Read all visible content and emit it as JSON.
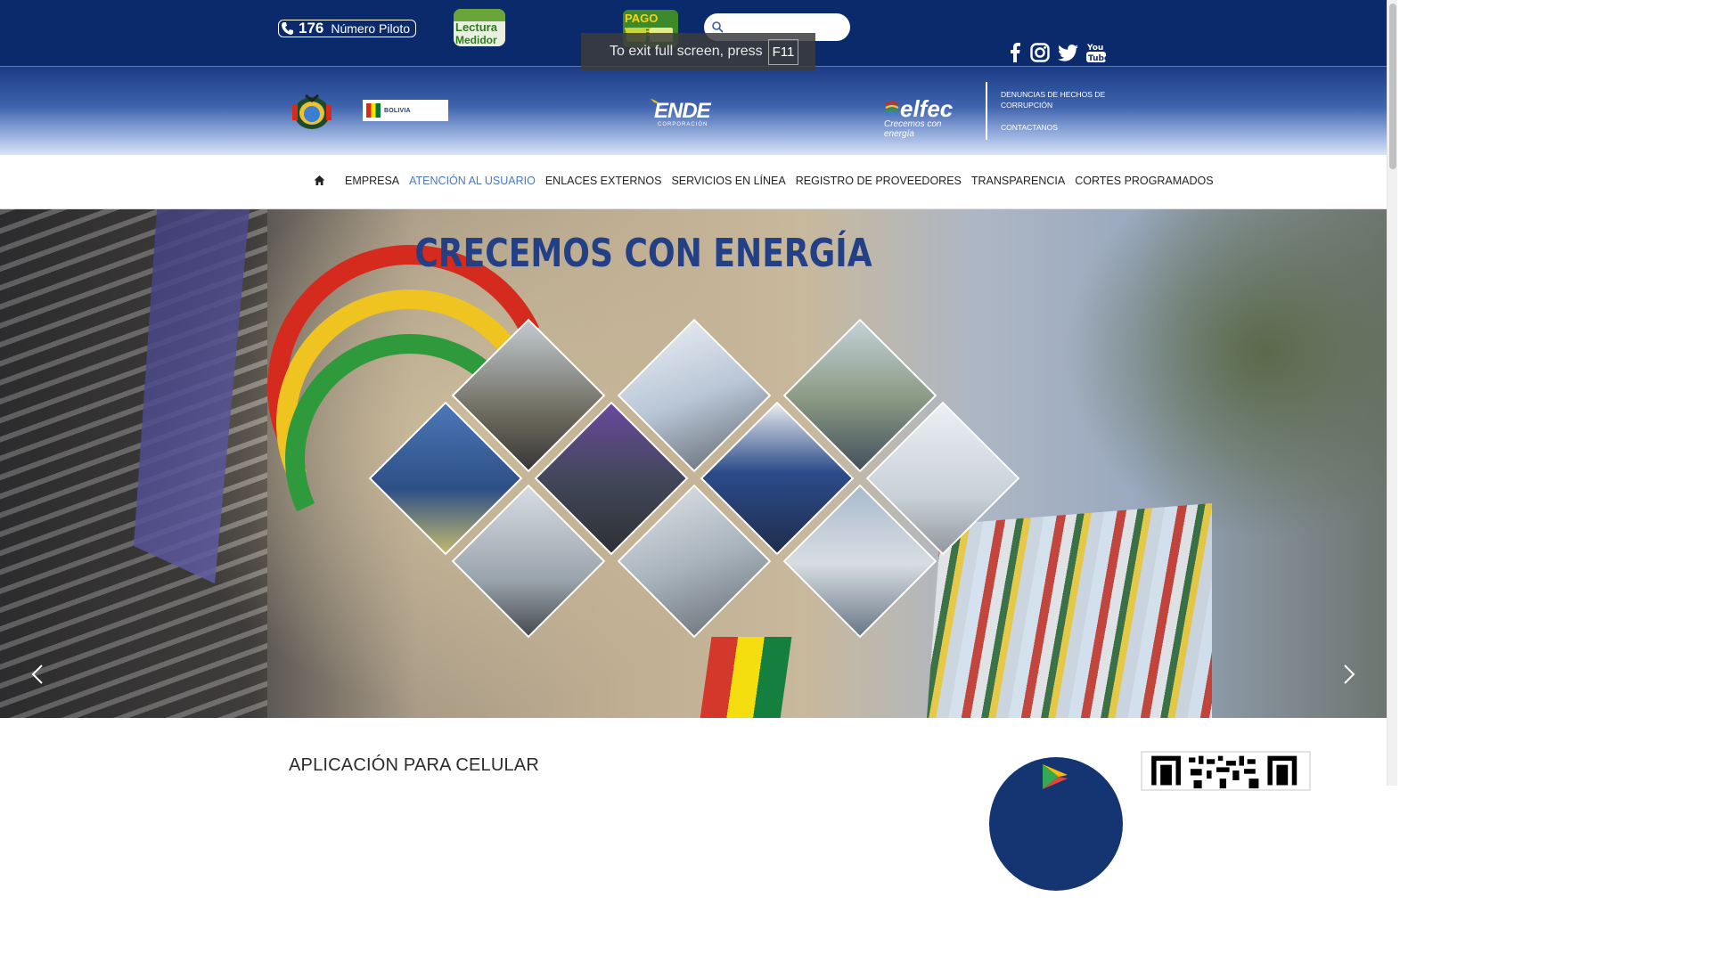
{
  "topbar": {
    "phone_number": "176",
    "phone_label": "Número Piloto",
    "lectura_line1": "Lectura",
    "lectura_line2": "Medidor",
    "pago_web": "PAGO WEB",
    "search_placeholder": "",
    "social": [
      "facebook-icon",
      "instagram-icon",
      "twitter-icon",
      "youtube-icon"
    ]
  },
  "fullscreen_notice": {
    "text": "To exit full screen, press",
    "key": "F11"
  },
  "logos": {
    "bolivia": "BOLIVIA",
    "ende": "ENDE",
    "ende_sub": "CORPORACIÓN",
    "elfec": "elfec",
    "elfec_tagline": "Crecemos con energía"
  },
  "sidelinks": {
    "denuncias": "DENUNCIAS DE HECHOS DE CORRUPCIÓN",
    "contactanos": "CONTACTANOS"
  },
  "nav": {
    "items": [
      {
        "label": "EMPRESA",
        "active": false
      },
      {
        "label": "ATENCIÓN AL USUARIO",
        "active": true
      },
      {
        "label": "ENLACES EXTERNOS",
        "active": false
      },
      {
        "label": "SERVICIOS EN LÍNEA",
        "active": false
      },
      {
        "label": "REGISTRO DE PROVEEDORES",
        "active": false
      },
      {
        "label": "TRANSPARENCIA",
        "active": false
      },
      {
        "label": "CORTES PROGRAMADOS",
        "active": false
      }
    ]
  },
  "hero": {
    "title": "CRECEMOS CON ENERGÍA"
  },
  "bottom": {
    "app_title": "APLICACIÓN PARA CELULAR"
  },
  "colors": {
    "topbar_bg": "#0a2a6b",
    "nav_active": "#4a78c2",
    "hero_title": "#233f86"
  }
}
